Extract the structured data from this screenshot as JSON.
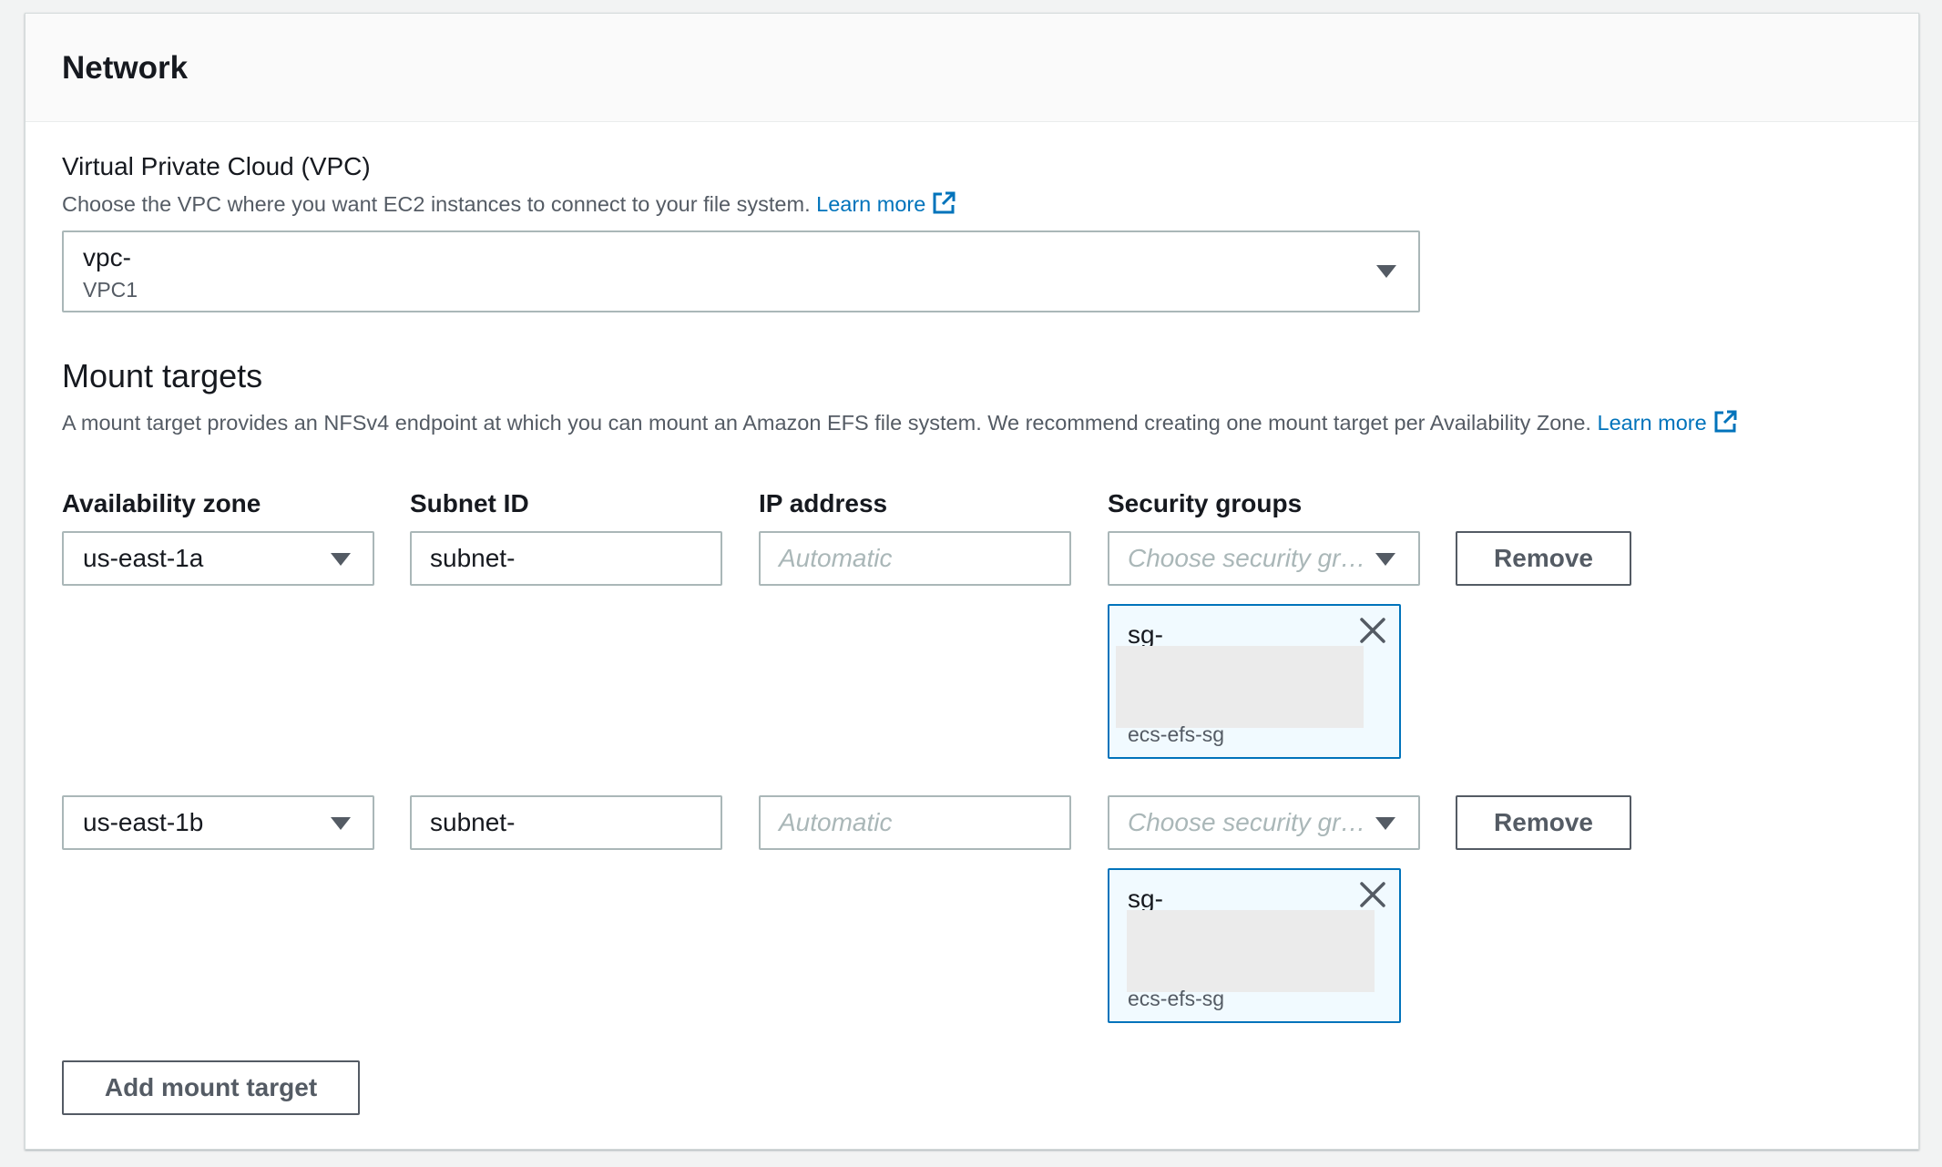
{
  "panel": {
    "title": "Network"
  },
  "vpc": {
    "label": "Virtual Private Cloud (VPC)",
    "description": "Choose the VPC where you want EC2 instances to connect to your file system.",
    "learn_more": "Learn more",
    "selected_id": "vpc-",
    "selected_name": "VPC1"
  },
  "mount_targets": {
    "heading": "Mount targets",
    "description": "A mount target provides an NFSv4 endpoint at which you can mount an Amazon EFS file system. We recommend creating one mount target per Availability Zone.",
    "learn_more": "Learn more",
    "columns": {
      "availability_zone": "Availability zone",
      "subnet_id": "Subnet ID",
      "ip_address": "IP address",
      "security_groups": "Security groups"
    },
    "rows": [
      {
        "availability_zone": "us-east-1a",
        "subnet_id": "subnet-",
        "ip_placeholder": "Automatic",
        "sg_placeholder": "Choose security gr…",
        "selected_sg": {
          "id": "sg-",
          "name": "ecs-efs-sg"
        },
        "remove_label": "Remove"
      },
      {
        "availability_zone": "us-east-1b",
        "subnet_id": "subnet-",
        "ip_placeholder": "Automatic",
        "sg_placeholder": "Choose security gr…",
        "selected_sg": {
          "id": "sg-",
          "name": "ecs-efs-sg"
        },
        "remove_label": "Remove"
      }
    ],
    "add_button": "Add mount target"
  },
  "colors": {
    "link": "#0073bb",
    "border": "#aab7b8",
    "token_bg": "#f1faff",
    "token_border": "#0073bb",
    "text": "#16191f",
    "secondary_text": "#545b64"
  },
  "icons": {
    "external_link": "external-link-icon",
    "dropdown": "caret-down-icon",
    "dismiss": "close-icon"
  }
}
